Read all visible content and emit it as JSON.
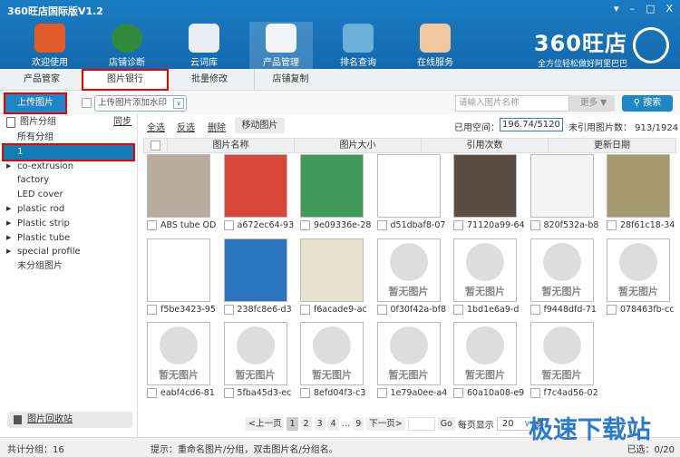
{
  "app": {
    "title": "360旺店国际版V1.2",
    "window_controls": [
      "▾",
      "–",
      "□",
      "X"
    ]
  },
  "nav": [
    {
      "label": "欢迎使用",
      "icon": "home-icon",
      "color": "#e05a2a"
    },
    {
      "label": "店铺诊断",
      "icon": "radar-icon",
      "color": "#2f8a3a"
    },
    {
      "label": "云词库",
      "icon": "cloud-icon",
      "color": "#e8eef5"
    },
    {
      "label": "产品管理",
      "icon": "clipboard-icon",
      "color": "#f2f4f7"
    },
    {
      "label": "排名查询",
      "icon": "magnifier-chart-icon",
      "color": "#6bb0d8"
    },
    {
      "label": "在线服务",
      "icon": "support-agent-icon",
      "color": "#f0c8a0"
    }
  ],
  "logo": {
    "name": "360旺店",
    "slogan": "全方位轻松做好阿里巴巴"
  },
  "tabs": [
    "产品管家",
    "图片银行",
    "批量修改",
    "店铺复制"
  ],
  "toolbar": {
    "upload": "上传图片",
    "watermark": "上传图片添加水印",
    "search_placeholder": "请输入图片名称",
    "more": "更多 ▼",
    "search": "搜索"
  },
  "sidebar": {
    "header": "图片分组",
    "sync": "同步",
    "items": [
      {
        "label": "所有分组",
        "expand": false
      },
      {
        "label": "1",
        "expand": false,
        "selected": true
      },
      {
        "label": "co-extrusion",
        "expand": true
      },
      {
        "label": "factory",
        "expand": false
      },
      {
        "label": "LED cover",
        "expand": false
      },
      {
        "label": "plastic rod",
        "expand": true
      },
      {
        "label": "Plastic strip",
        "expand": true
      },
      {
        "label": "Plastic tube",
        "expand": true
      },
      {
        "label": "special profile",
        "expand": true
      },
      {
        "label": "未分组图片",
        "expand": false
      }
    ],
    "recycle": "图片回收站",
    "total": "共计分组：16"
  },
  "actions": {
    "select_all": "全选",
    "invert": "反选",
    "delete": "删除",
    "move": "移动图片",
    "space_label": "已用空间：",
    "space_value": "196.74/5120",
    "unref": "未引用图片数： 913/1924"
  },
  "columns": [
    "图片名称",
    "图片大小",
    "引用次数",
    "更新日期"
  ],
  "images": [
    {
      "name": "ABS tube OD",
      "color": "#b8ad9c"
    },
    {
      "name": "a672ec64-93",
      "color": "#d9473a"
    },
    {
      "name": "9e09336e-28",
      "color": "#3d9a5a"
    },
    {
      "name": "d51dbaf8-07",
      "color": "#fff"
    },
    {
      "name": "71120a99-64",
      "color": "#5a4d44"
    },
    {
      "name": "820f532a-b8",
      "color": "#f4f4f4"
    },
    {
      "name": "28f61c18-34",
      "color": "#a89a70"
    },
    {
      "name": "f5be3423-95",
      "color": "#fff"
    },
    {
      "name": "238fc8e6-d3",
      "color": "#2b74c0"
    },
    {
      "name": "f6acade9-ac",
      "color": "#e8e2d0"
    },
    {
      "name": "0f30f42a-bf8",
      "noimg": true
    },
    {
      "name": "1bd1e6a9-d",
      "noimg": true
    },
    {
      "name": "f9448dfd-71",
      "noimg": true
    },
    {
      "name": "078463fb-cc",
      "noimg": true
    },
    {
      "name": "eabf4cd6-81",
      "noimg": true
    },
    {
      "name": "5fba45d3-ec",
      "noimg": true
    },
    {
      "name": "8efd04f3-c3",
      "noimg": true
    },
    {
      "name": "1e79a0ee-a4",
      "noimg": true
    },
    {
      "name": "60a10a08-e9",
      "noimg": true
    },
    {
      "name": "f7c4ad56-02",
      "noimg": true
    }
  ],
  "no_image_text": "暂无图片",
  "pager": {
    "prev": "<上一页",
    "pages": [
      "1",
      "2",
      "3",
      "4",
      "...",
      "9"
    ],
    "next": "下一页>",
    "go": "Go",
    "per_page_label": "每页显示",
    "per_page": "20",
    "unit": "条"
  },
  "status": {
    "hint": "提示：重命名图片/分组，双击图片名/分组名。",
    "selected": "已选：0/20"
  },
  "watermark": "极速下载站"
}
